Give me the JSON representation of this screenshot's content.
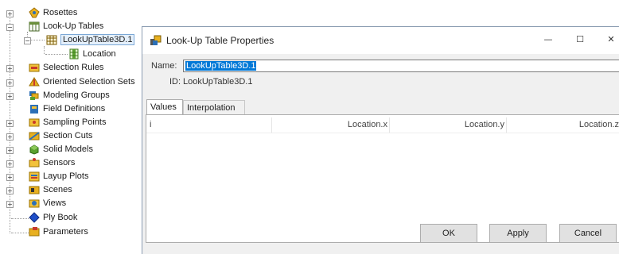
{
  "tree": {
    "items": [
      {
        "label": "Rosettes",
        "icon": "rosettes-icon"
      },
      {
        "label": "Look-Up Tables",
        "icon": "lookup-tables-icon"
      },
      {
        "label": "LookUpTable3D.1",
        "icon": "table-icon"
      },
      {
        "label": "Location",
        "icon": "table-column-icon"
      },
      {
        "label": "Selection Rules",
        "icon": "selection-rules-icon"
      },
      {
        "label": "Oriented Selection Sets",
        "icon": "oriented-selection-sets-icon"
      },
      {
        "label": "Modeling Groups",
        "icon": "modeling-groups-icon"
      },
      {
        "label": "Field Definitions",
        "icon": "field-definitions-icon"
      },
      {
        "label": "Sampling Points",
        "icon": "sampling-points-icon"
      },
      {
        "label": "Section Cuts",
        "icon": "section-cuts-icon"
      },
      {
        "label": "Solid Models",
        "icon": "solid-models-icon"
      },
      {
        "label": "Sensors",
        "icon": "sensors-icon"
      },
      {
        "label": "Layup Plots",
        "icon": "layup-plots-icon"
      },
      {
        "label": "Scenes",
        "icon": "scenes-icon"
      },
      {
        "label": "Views",
        "icon": "views-icon"
      },
      {
        "label": "Ply Book",
        "icon": "ply-book-icon"
      },
      {
        "label": "Parameters",
        "icon": "parameters-icon"
      }
    ]
  },
  "dialog": {
    "title": "Look-Up Table Properties",
    "controls": {
      "minimize": "—",
      "maximize": "☐",
      "close": "✕"
    },
    "name_label": "Name:",
    "name_value": "LookUpTable3D.1",
    "id_label": "ID:",
    "id_value": "LookUpTable3D.1",
    "tabs": [
      "Values",
      "Interpolation"
    ],
    "columns": [
      "i",
      "Location.x",
      "Location.y",
      "Location.z"
    ],
    "buttons": {
      "ok": "OK",
      "apply": "Apply",
      "cancel": "Cancel"
    }
  }
}
